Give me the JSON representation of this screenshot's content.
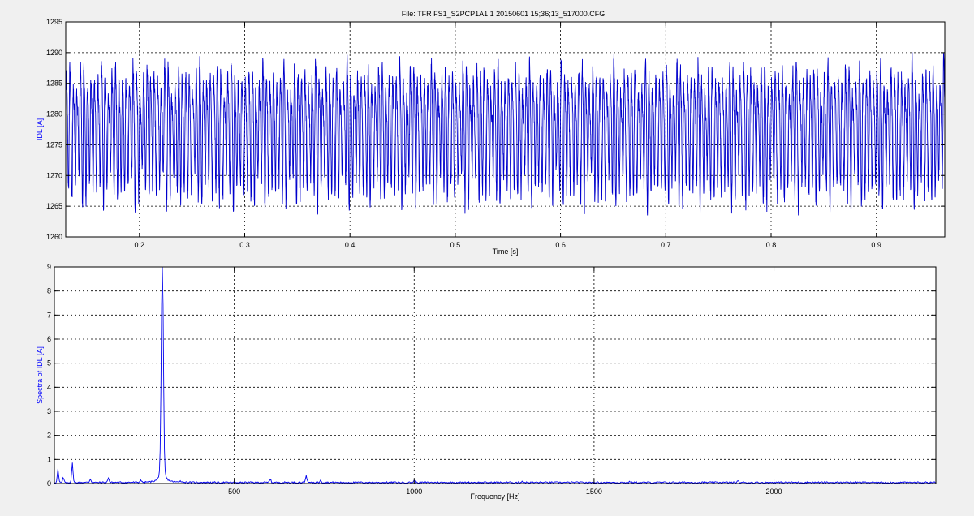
{
  "figure_title": "File: TFR FS1_S2PCP1A1 1 20150601 15;36;13_517000.CFG",
  "colors": {
    "background": "#f0f0f0",
    "axes_face": "#ffffff",
    "series_top": "#0000cc",
    "series_bottom": "#0000ee",
    "ylabel_color": "#0000ff",
    "grid": "#000000"
  },
  "chart_data": [
    {
      "type": "line",
      "title": "File: TFR FS1_S2PCP1A1 1 20150601 15;36;13_517000.CFG",
      "xlabel": "Time [s]",
      "ylabel": "IDL [A]",
      "xlim": [
        0.13,
        0.965
      ],
      "ylim": [
        1260,
        1295
      ],
      "xticks": [
        0.2,
        0.3,
        0.4,
        0.5,
        0.6,
        0.7,
        0.8,
        0.9
      ],
      "xtick_labels": [
        "0.2",
        "0.3",
        "0.4",
        "0.5",
        "0.6",
        "0.7",
        "0.8",
        "0.9"
      ],
      "yticks": [
        1260,
        1265,
        1270,
        1275,
        1280,
        1285,
        1290,
        1295
      ],
      "ytick_labels": [
        "1260",
        "1265",
        "1270",
        "1275",
        "1280",
        "1285",
        "1290",
        "1295"
      ],
      "grid": true,
      "series": [
        {
          "signal": "ripple",
          "mean": 1277.8,
          "dominant_frequency_hz": 300,
          "amplitude": 10,
          "range": [
            1263.5,
            1290.8
          ]
        }
      ]
    },
    {
      "type": "line",
      "xlabel": "Frequency [Hz]",
      "ylabel": "Spectra of IDL [A]",
      "xlim": [
        0,
        2450
      ],
      "ylim": [
        0,
        9
      ],
      "xticks": [
        500,
        1000,
        1500,
        2000
      ],
      "xtick_labels": [
        "500",
        "1000",
        "1500",
        "2000"
      ],
      "yticks": [
        0,
        1,
        2,
        3,
        4,
        5,
        6,
        7,
        8,
        9
      ],
      "ytick_labels": [
        "0",
        "1",
        "2",
        "3",
        "4",
        "5",
        "6",
        "7",
        "8",
        "9"
      ],
      "grid": true,
      "series": [
        {
          "peaks": [
            {
              "x": 10,
              "y": 0.55
            },
            {
              "x": 25,
              "y": 0.2
            },
            {
              "x": 50,
              "y": 0.85
            },
            {
              "x": 100,
              "y": 0.15
            },
            {
              "x": 150,
              "y": 0.2
            },
            {
              "x": 240,
              "y": 0.1
            },
            {
              "x": 300,
              "y": 8.4
            },
            {
              "x": 350,
              "y": 0.08
            },
            {
              "x": 600,
              "y": 0.15
            },
            {
              "x": 700,
              "y": 0.3
            },
            {
              "x": 740,
              "y": 0.12
            },
            {
              "x": 1000,
              "y": 0.08
            },
            {
              "x": 1300,
              "y": 0.05
            },
            {
              "x": 1600,
              "y": 0.04
            },
            {
              "x": 1900,
              "y": 0.05
            },
            {
              "x": 2200,
              "y": 0.04
            }
          ],
          "noise_floor": 0.05
        }
      ]
    }
  ]
}
